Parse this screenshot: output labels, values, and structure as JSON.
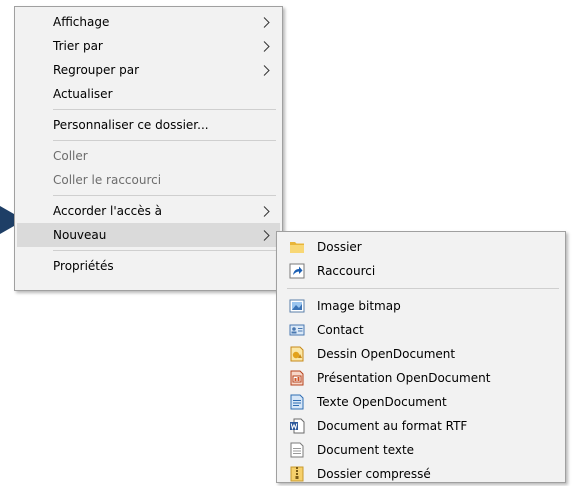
{
  "context_menu": {
    "items": [
      {
        "label": "Affichage"
      },
      {
        "label": "Trier par"
      },
      {
        "label": "Regrouper par"
      },
      {
        "label": "Actualiser"
      },
      {
        "label": "Personnaliser ce dossier..."
      },
      {
        "label": "Coller"
      },
      {
        "label": "Coller le raccourci"
      },
      {
        "label": "Accorder l'accès à"
      },
      {
        "label": "Nouveau"
      },
      {
        "label": "Propriétés"
      }
    ],
    "disabled_items": [
      "Coller",
      "Coller le raccourci"
    ],
    "highlighted_item": "Nouveau",
    "submenu_arrow_icon": "chevron-right-icon"
  },
  "new_submenu": {
    "items": [
      {
        "label": "Dossier",
        "icon": "folder-icon"
      },
      {
        "label": "Raccourci",
        "icon": "shortcut-icon"
      },
      {
        "label": "Image bitmap",
        "icon": "bitmap-image-icon"
      },
      {
        "label": "Contact",
        "icon": "contact-card-icon"
      },
      {
        "label": "Dessin OpenDocument",
        "icon": "opendocument-drawing-icon"
      },
      {
        "label": "Présentation OpenDocument",
        "icon": "opendocument-presentation-icon"
      },
      {
        "label": "Texte OpenDocument",
        "icon": "opendocument-text-icon"
      },
      {
        "label": "Document au format RTF",
        "icon": "rtf-document-icon"
      },
      {
        "label": "Document texte",
        "icon": "text-document-icon"
      },
      {
        "label": "Dossier compressé",
        "icon": "zip-folder-icon"
      }
    ]
  },
  "colors": {
    "menu_background": "#f2f2f2",
    "menu_border": "#a0a0a0",
    "highlight": "#dadada",
    "disabled_text": "#6d6d6d",
    "desktop_accent": "#1e3f66"
  }
}
